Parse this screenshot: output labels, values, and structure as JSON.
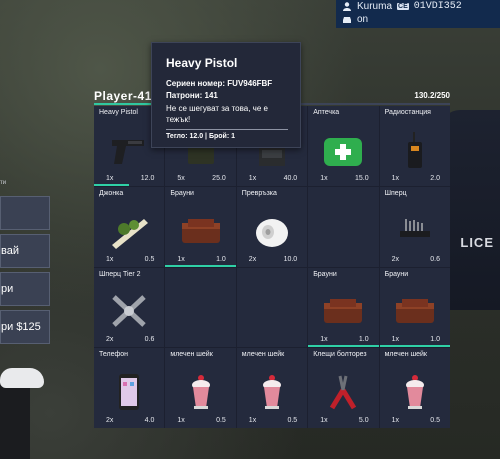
{
  "status": {
    "player_name": "Kuruma",
    "plate": "01VDI352",
    "engine_state": "on"
  },
  "left_menu": {
    "header": "ти",
    "buttons": [
      {
        "label": ""
      },
      {
        "label": "вай"
      },
      {
        "label": "ри"
      },
      {
        "label": "ри $125"
      }
    ]
  },
  "inventory": {
    "owner": "Player-41",
    "weight": "130.2/250",
    "weight_fraction": 0.5208,
    "slots": [
      {
        "name": "Heavy Pistol",
        "qty": "1x",
        "weight": "12.0",
        "icon": "pistol-icon",
        "durability": 0.5
      },
      {
        "name": "",
        "qty": "5x",
        "weight": "25.0",
        "icon": "ammo-icon",
        "durability": 0
      },
      {
        "name": "",
        "qty": "1x",
        "weight": "40.0",
        "icon": "vest-icon",
        "durability": 0
      },
      {
        "name": "Аптечка",
        "qty": "1x",
        "weight": "15.0",
        "icon": "medkit-icon",
        "durability": 0
      },
      {
        "name": "Радиостанция",
        "qty": "1x",
        "weight": "2.0",
        "icon": "radio-icon",
        "durability": 0
      },
      {
        "name": "Джонка",
        "qty": "1x",
        "weight": "0.5",
        "icon": "joint-icon",
        "durability": 0
      },
      {
        "name": "Брауни",
        "qty": "1x",
        "weight": "1.0",
        "icon": "brownie-icon",
        "durability": 1
      },
      {
        "name": "Превръзка",
        "qty": "2x",
        "weight": "10.0",
        "icon": "bandage-icon",
        "durability": 0
      },
      {
        "name": "",
        "qty": "",
        "weight": "",
        "icon": "",
        "durability": 0
      },
      {
        "name": "Шперц",
        "qty": "2x",
        "weight": "0.6",
        "icon": "lockpick-icon",
        "durability": 0
      },
      {
        "name": "Шперц Tier 2",
        "qty": "2x",
        "weight": "0.6",
        "icon": "lockpick-t2-icon",
        "durability": 0
      },
      {
        "name": "",
        "qty": "",
        "weight": "",
        "icon": "",
        "durability": 0
      },
      {
        "name": "",
        "qty": "",
        "weight": "",
        "icon": "",
        "durability": 0
      },
      {
        "name": "Брауни",
        "qty": "1x",
        "weight": "1.0",
        "icon": "brownie-icon",
        "durability": 1
      },
      {
        "name": "Брауни",
        "qty": "1x",
        "weight": "1.0",
        "icon": "brownie-icon",
        "durability": 1
      },
      {
        "name": "Телефон",
        "qty": "2x",
        "weight": "4.0",
        "icon": "phone-icon",
        "durability": 0
      },
      {
        "name": "млечен шейк",
        "qty": "1x",
        "weight": "0.5",
        "icon": "milkshake-icon",
        "durability": 0
      },
      {
        "name": "млечен шейк",
        "qty": "1x",
        "weight": "0.5",
        "icon": "milkshake-icon",
        "durability": 0
      },
      {
        "name": "Клещи болторез",
        "qty": "1x",
        "weight": "5.0",
        "icon": "boltcutter-icon",
        "durability": 0
      },
      {
        "name": "млечен шейк",
        "qty": "1x",
        "weight": "0.5",
        "icon": "milkshake-icon",
        "durability": 0
      }
    ]
  },
  "tooltip": {
    "title": "Heavy Pistol",
    "serial": "Сериен номер: FUV946FBF",
    "ammo": "Патрони: 141",
    "line1": "Не се шегуват за това, че е",
    "line2": "тежък!",
    "footer": "Тегло: 12.0 | Брой: 1"
  },
  "colors": {
    "accent": "#30c8a0",
    "panel": "#242a3d",
    "status_bg": "#122a4d"
  }
}
